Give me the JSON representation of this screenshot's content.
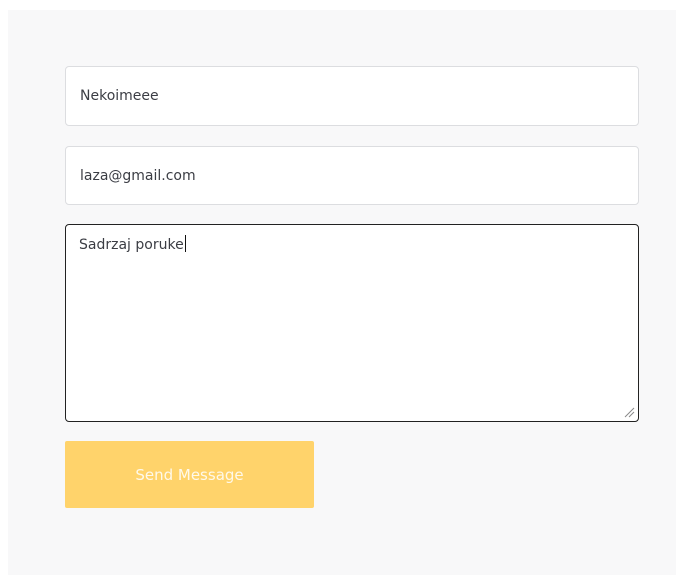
{
  "form": {
    "name_value": "Nekoimeee",
    "email_value": "laza@gmail.com",
    "message_value": "Sadrzaj poruke",
    "send_label": "Send Message"
  },
  "colors": {
    "panel_background": "#f8f8f9",
    "button_background": "#ffd36b",
    "button_text": "#fff9ea",
    "focused_border": "#222222"
  },
  "icons": {
    "resize": "resize-handle-icon"
  }
}
